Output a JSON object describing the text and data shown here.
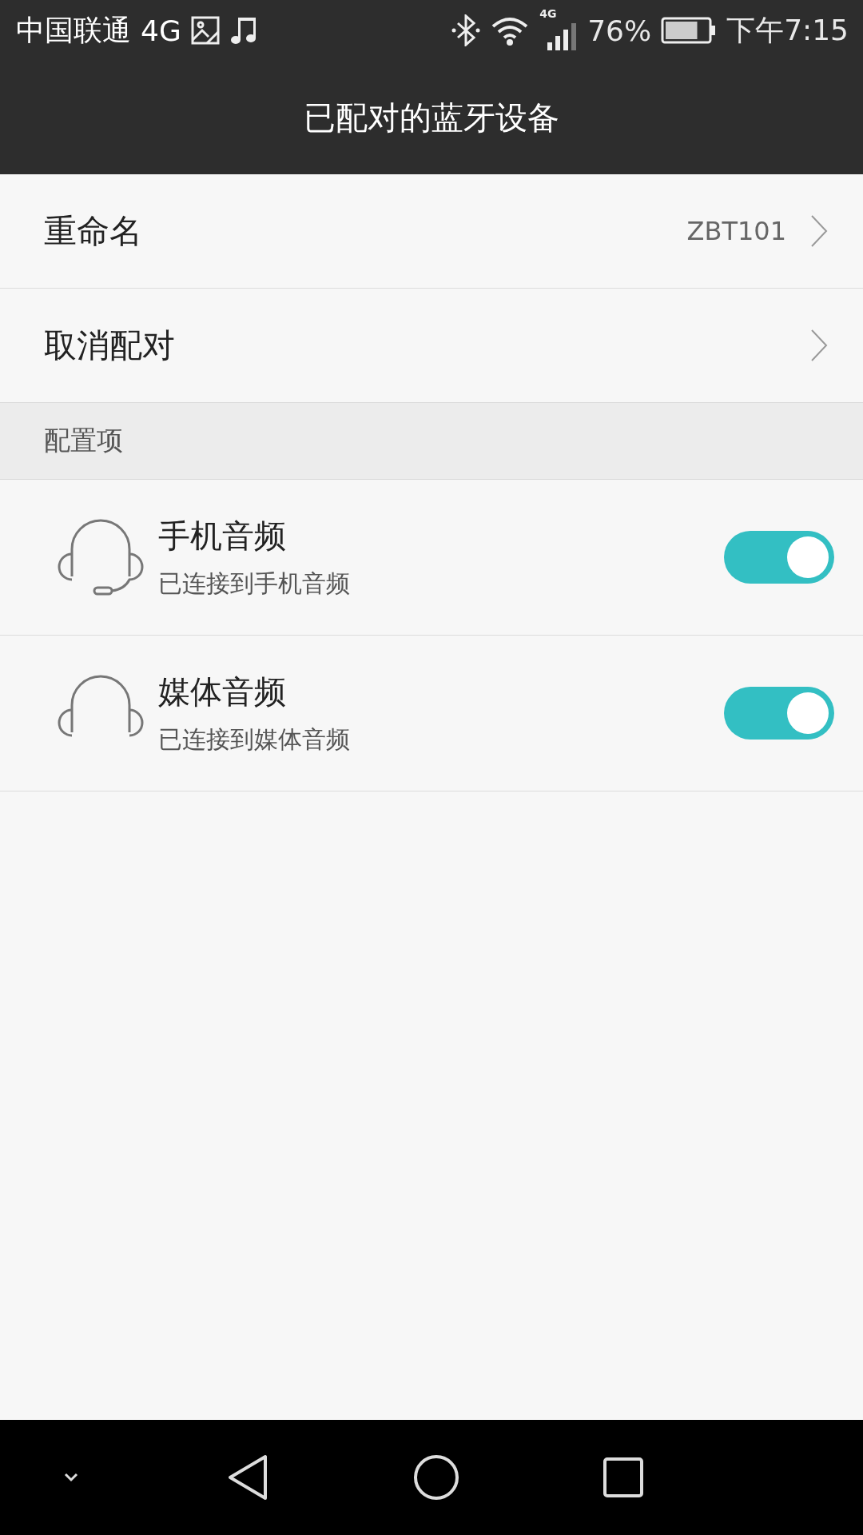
{
  "status_bar": {
    "carrier": "中国联通",
    "network": "4G",
    "signal_network": "4G",
    "battery": {
      "percent": "76%",
      "level": 0.76
    },
    "time": "下午7:15"
  },
  "title": "已配对的蓝牙设备",
  "actions": [
    {
      "label": "重命名",
      "value": "ZBT101"
    },
    {
      "label": "取消配对"
    }
  ],
  "section": {
    "title": "配置项"
  },
  "profiles": [
    {
      "kind": "headset",
      "name": "手机音频",
      "status": "已连接到手机音频",
      "on": true
    },
    {
      "kind": "headphones",
      "name": "媒体音频",
      "status": "已连接到媒体音频",
      "on": true
    }
  ]
}
